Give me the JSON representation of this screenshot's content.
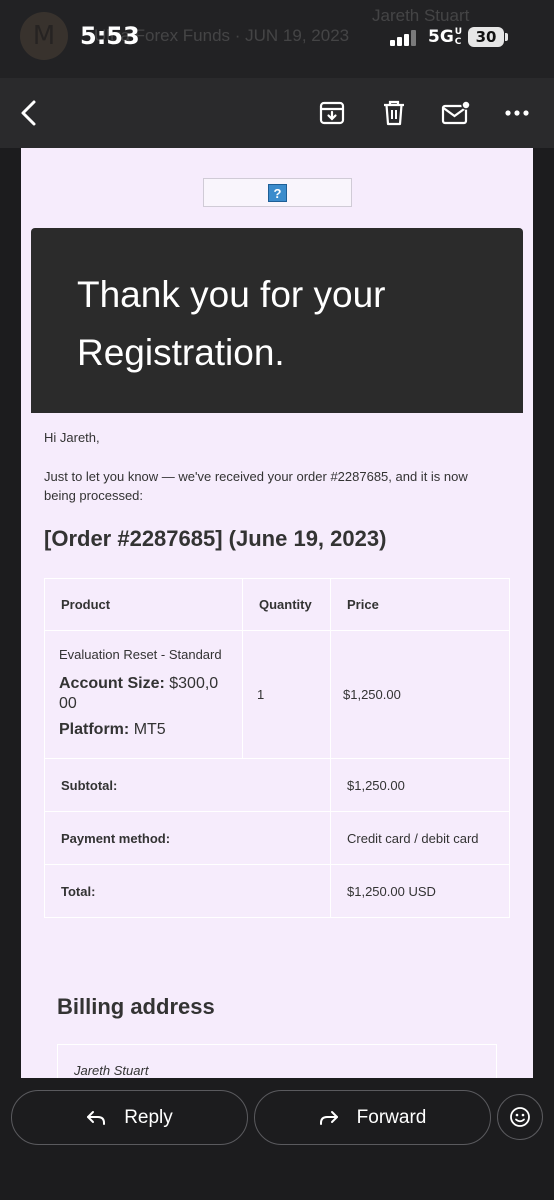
{
  "status_bar": {
    "time": "5:53",
    "network": "5G",
    "network_suffix": "UC",
    "battery": "30",
    "notification_avatar": "M",
    "notification_text": "Ultra Forex Funds · JUN 19, 2023",
    "notification_right": "Jareth Stuart"
  },
  "toolbar": {
    "icons": [
      "back-arrow-icon",
      "archive-icon",
      "trash-icon",
      "mark-unread-icon",
      "more-icon"
    ]
  },
  "email": {
    "broken_image_glyph": "?",
    "hero_title": "Thank you for your Registration.",
    "greeting": "Hi Jareth,",
    "intro": "Just to let you know — we've received your order #2287685, and it is now being processed:",
    "order_heading": "[Order #2287685] (June 19, 2023)",
    "table": {
      "headers": {
        "product": "Product",
        "quantity": "Quantity",
        "price": "Price"
      },
      "item": {
        "name": "Evaluation Reset - Standard",
        "account_size_label": "Account Size:",
        "account_size_value": "$300,000",
        "platform_label": "Platform:",
        "platform_value": "MT5",
        "quantity": "1",
        "price": "$1,250.00"
      },
      "subtotal_label": "Subtotal:",
      "subtotal_value": "$1,250.00",
      "payment_label": "Payment method:",
      "payment_value": "Credit card / debit card",
      "total_label": "Total:",
      "total_value": "$1,250.00 USD"
    },
    "billing_heading": "Billing address",
    "billing_name": "Jareth Stuart"
  },
  "bottom_bar": {
    "reply_label": "Reply",
    "forward_label": "Forward"
  },
  "colors": {
    "email_bg": "#f6ecfc",
    "hero_bg": "#2b2b2b",
    "app_bg": "#1c1c1e",
    "toolbar_bg": "#2a2a2c"
  }
}
